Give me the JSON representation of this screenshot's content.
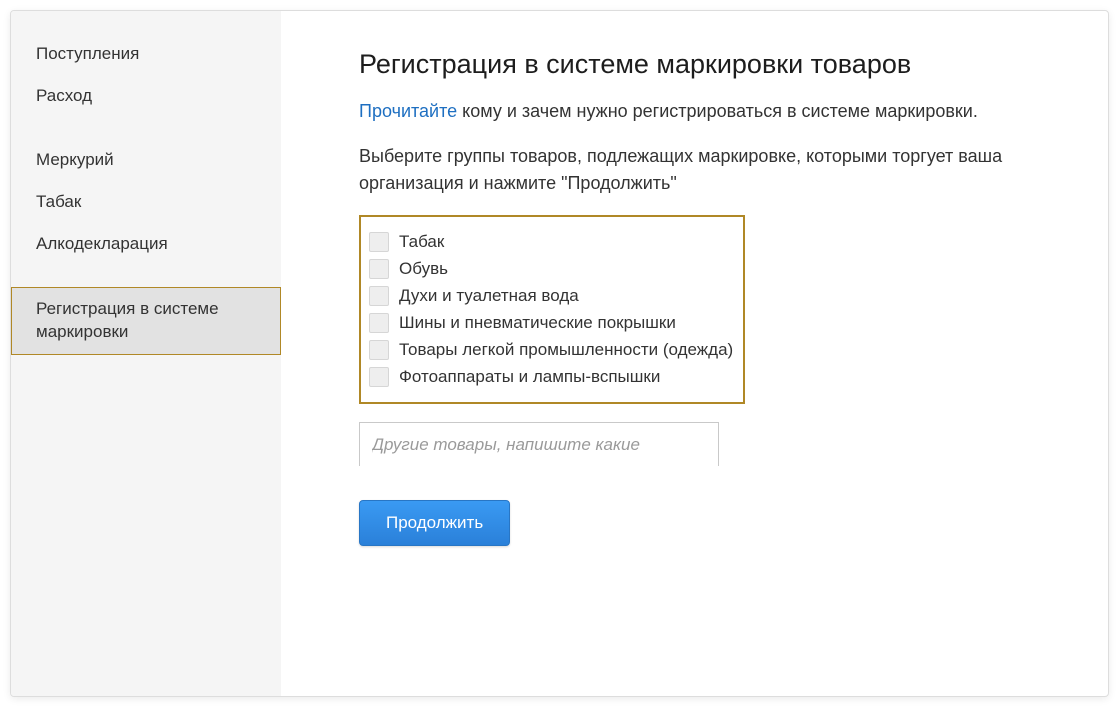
{
  "sidebar": {
    "group1": [
      {
        "label": "Поступления"
      },
      {
        "label": "Расход"
      }
    ],
    "group2": [
      {
        "label": "Меркурий"
      },
      {
        "label": "Табак"
      },
      {
        "label": "Алкодекларация"
      }
    ],
    "active": {
      "label": "Регистрация в системе маркировки"
    }
  },
  "main": {
    "title": "Регистрация в системе маркировки товаров",
    "intro_link": "Прочитайте",
    "intro_rest": " кому и зачем нужно регистрироваться в системе маркировки.",
    "instruction": "Выберите группы товаров, подлежащих маркировке, которыми торгует ваша организация и нажмите \"Продолжить\"",
    "checkboxes": [
      "Табак",
      "Обувь",
      "Духи и туалетная вода",
      "Шины и пневматические покрышки",
      "Товары легкой промышленности (одежда)",
      "Фотоаппараты и лампы-вспышки"
    ],
    "other_placeholder": "Другие товары, напишите какие",
    "continue_btn": "Продолжить"
  }
}
